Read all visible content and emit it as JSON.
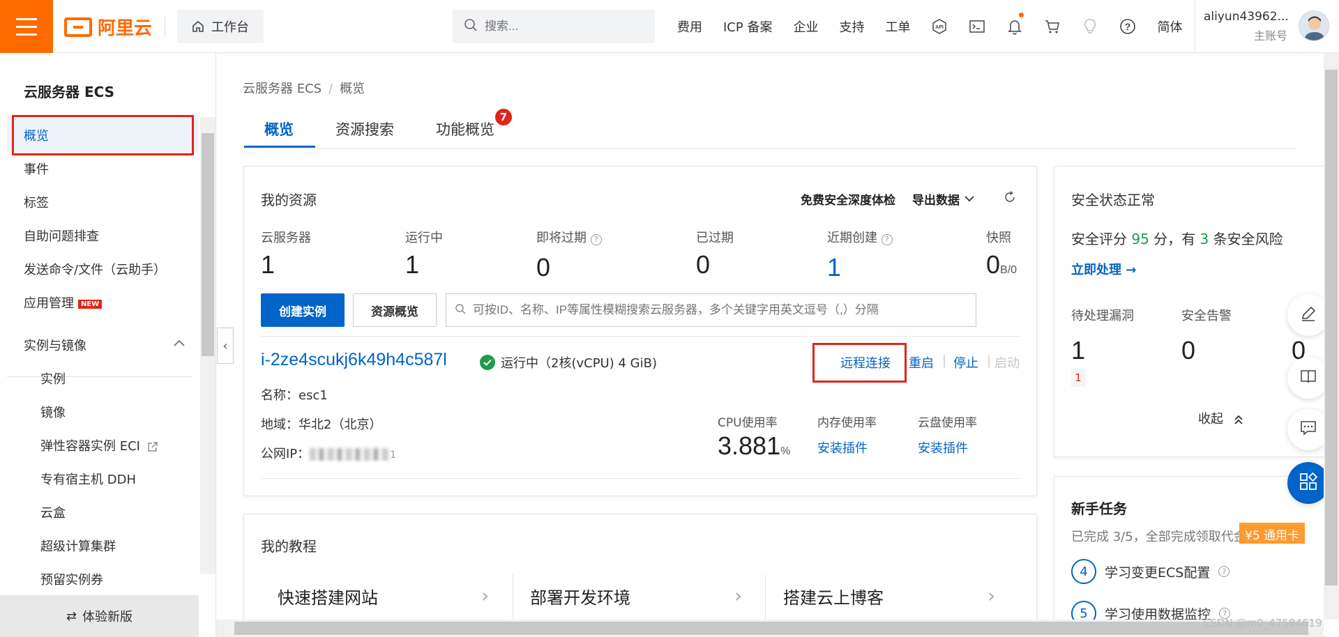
{
  "topbar": {
    "logo_text": "阿里云",
    "workbench": "工作台",
    "search_placeholder": "搜索...",
    "nav": [
      "费用",
      "ICP 备案",
      "企业",
      "支持",
      "工单"
    ],
    "lang": "简体",
    "user_name": "aliyun43962...",
    "user_role": "主账号"
  },
  "sidebar": {
    "title": "云服务器 ECS",
    "items": [
      "概览",
      "事件",
      "标签",
      "自助问题排查",
      "发送命令/文件（云助手）",
      "应用管理"
    ],
    "new_badge": "NEW",
    "group": "实例与镜像",
    "sub_items": [
      "实例",
      "镜像",
      "弹性容器实例 ECI",
      "专有宿主机 DDH",
      "云盒",
      "超级计算集群",
      "预留实例券"
    ],
    "footer": "体验新版"
  },
  "breadcrumb": [
    "云服务器 ECS",
    "概览"
  ],
  "tabs": [
    "概览",
    "资源搜索",
    "功能概览"
  ],
  "tab_badge": "7",
  "resources": {
    "title": "我的资源",
    "free_check": "免费安全深度体检",
    "export": "导出数据",
    "stats": [
      {
        "label": "云服务器",
        "value": "1"
      },
      {
        "label": "运行中",
        "value": "1"
      },
      {
        "label": "即将过期",
        "value": "0"
      },
      {
        "label": "已过期",
        "value": "0"
      },
      {
        "label": "近期创建",
        "value": "1"
      },
      {
        "label": "快照",
        "value": "0",
        "unit": "B/0"
      }
    ],
    "create_btn": "创建实例",
    "overview_btn": "资源概览",
    "search_placeholder": "可按ID、名称、IP等属性模糊搜索云服务器，多个关键字用英文逗号（,）分隔",
    "instance": {
      "id": "i-2ze4scukj6k49h4c587l",
      "status": "运行中（2核(vCPU) 4 GiB)",
      "actions": [
        "远程连接",
        "重启",
        "停止",
        "启动"
      ],
      "name": "名称：esc1",
      "region": "地域：华北2（北京）",
      "ip_label": "公网IP：",
      "ip_tail": "1",
      "cpu_label": "CPU使用率",
      "cpu_value": "3.881",
      "cpu_unit": "%",
      "mem_label": "内存使用率",
      "disk_label": "云盘使用率",
      "install": "安装插件"
    }
  },
  "tutorial": {
    "title": "我的教程",
    "items": [
      "快速搭建网站",
      "部署开发环境",
      "搭建云上博客"
    ]
  },
  "security": {
    "title": "安全状态正常",
    "score_prefix": "安全评分",
    "score": "95",
    "score_mid": "分，有",
    "risk_count": "3",
    "score_suffix": "条安全风险",
    "action": "立即处理 →",
    "labels": [
      "待处理漏洞",
      "安全告警"
    ],
    "values": [
      "1",
      "0",
      "0"
    ],
    "badge": "1",
    "collapse": "收起"
  },
  "tasks": {
    "title": "新手任务",
    "progress": "已完成 3/5，全部完成领取代金券",
    "reward": "¥5 通用卡",
    "items": [
      {
        "num": "4",
        "label": "学习变更ECS配置"
      },
      {
        "num": "5",
        "label": "学习使用数据监控"
      }
    ]
  },
  "watermark": "CSDN @m0_47584619",
  "colors": {
    "brand": "#ff6a00",
    "primary": "#0064c8",
    "success": "#1a9e4a",
    "danger": "#e1251b"
  }
}
